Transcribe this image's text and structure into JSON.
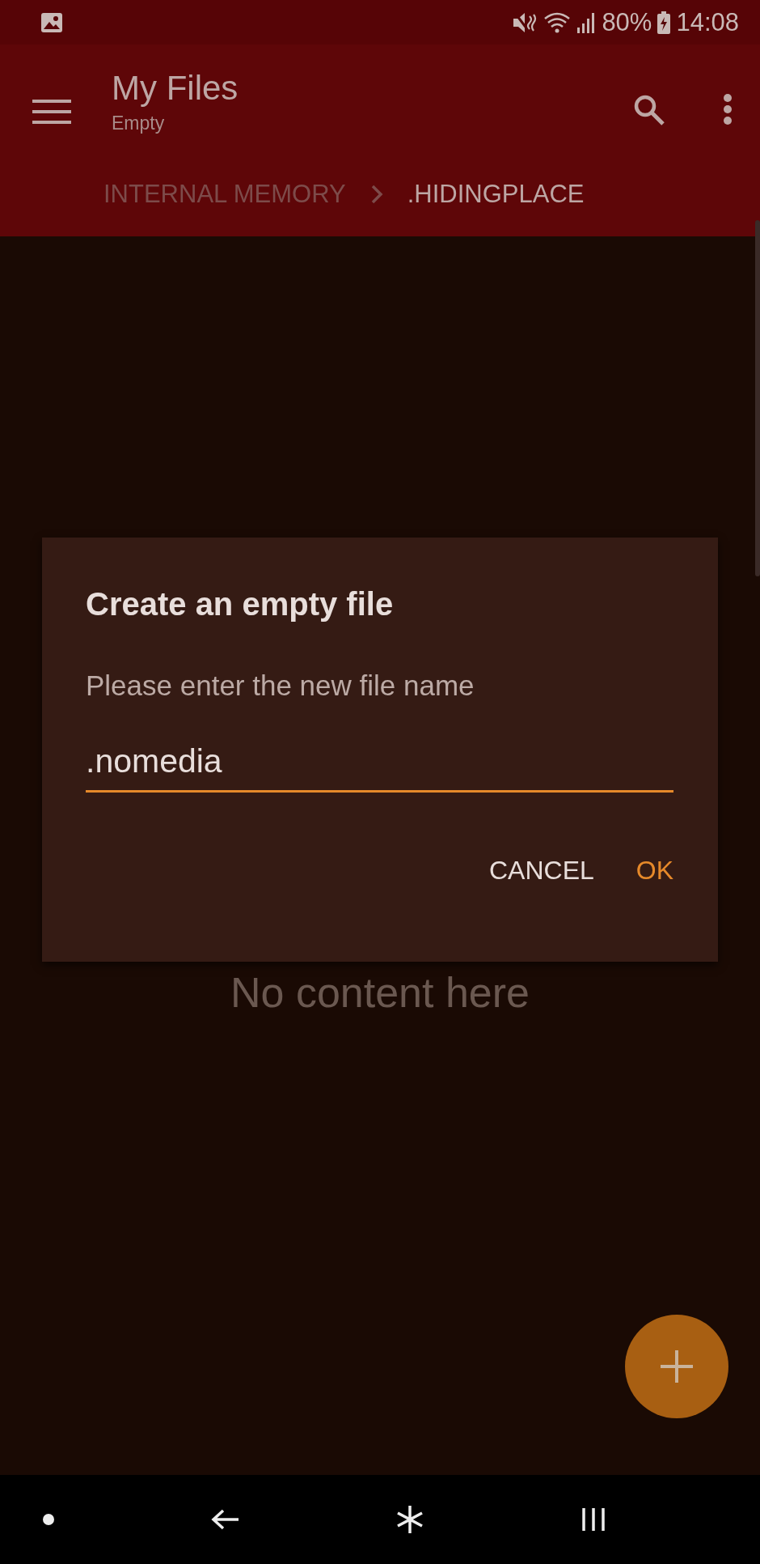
{
  "status_bar": {
    "battery": "80%",
    "time": "14:08"
  },
  "toolbar": {
    "title": "My Files",
    "subtitle": "Empty"
  },
  "breadcrumbs": [
    {
      "label": "INTERNAL MEMORY",
      "selected": false
    },
    {
      "label": ".HIDINGPLACE",
      "selected": true
    }
  ],
  "empty_message": "No content here",
  "dialog": {
    "title": "Create an empty file",
    "message": "Please enter the new file name",
    "value": ".nomedia",
    "buttons": [
      {
        "label": "CANCEL",
        "kind": "neutral"
      },
      {
        "label": "OK",
        "kind": "positive"
      }
    ]
  }
}
